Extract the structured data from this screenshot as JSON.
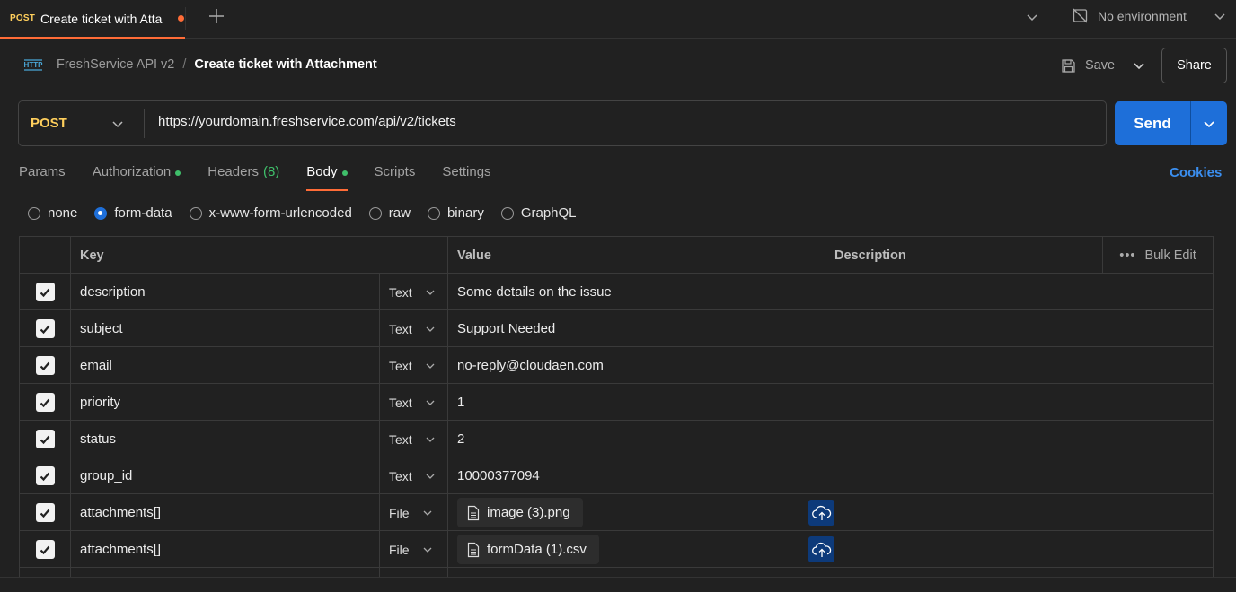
{
  "tab": {
    "method": "POST",
    "title": "Create ticket with Atta"
  },
  "environment": {
    "label": "No environment"
  },
  "header": {
    "collection": "FreshService API v2",
    "separator": "/",
    "request_name": "Create ticket with Attachment",
    "save_label": "Save",
    "share_label": "Share"
  },
  "request": {
    "method": "POST",
    "url": "https://yourdomain.freshservice.com/api/v2/tickets",
    "send_label": "Send"
  },
  "req_tabs": {
    "params": "Params",
    "authorization": "Authorization",
    "headers": "Headers",
    "headers_count": "(8)",
    "body": "Body",
    "scripts": "Scripts",
    "settings": "Settings",
    "cookies": "Cookies"
  },
  "body_types": {
    "none": "none",
    "form_data": "form-data",
    "urlencoded": "x-www-form-urlencoded",
    "raw": "raw",
    "binary": "binary",
    "graphql": "GraphQL",
    "selected": "form-data"
  },
  "table": {
    "headers": {
      "key": "Key",
      "value": "Value",
      "description": "Description",
      "bulk_edit": "Bulk Edit"
    },
    "rows": [
      {
        "key": "description",
        "type": "Text",
        "value": "Some details on the issue"
      },
      {
        "key": "subject",
        "type": "Text",
        "value": "Support Needed"
      },
      {
        "key": "email",
        "type": "Text",
        "value": "no-reply@cloudaen.com"
      },
      {
        "key": "priority",
        "type": "Text",
        "value": "1"
      },
      {
        "key": "status",
        "type": "Text",
        "value": "2"
      },
      {
        "key": "group_id",
        "type": "Text",
        "value": "10000377094"
      },
      {
        "key": "attachments[]",
        "type": "File",
        "value": "image (3).png"
      },
      {
        "key": "attachments[]",
        "type": "File",
        "value": "formData (1).csv"
      }
    ]
  },
  "colors": {
    "accent": "#ff6c37",
    "primary": "#1e6fd9",
    "method": "#ffcf5c",
    "success": "#3fbf6a",
    "link": "#3b8ff0"
  }
}
